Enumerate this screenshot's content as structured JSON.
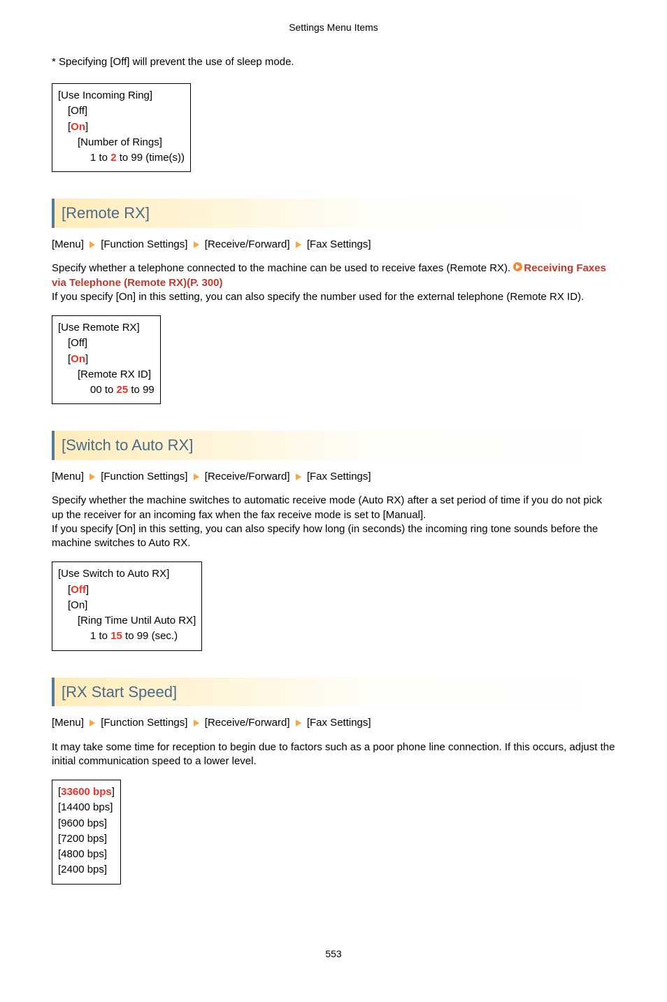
{
  "header": "Settings Menu Items",
  "note": "* Specifying [Off] will prevent the use of sleep mode.",
  "page_number": "553",
  "box1": {
    "l1": "[Use Incoming Ring]",
    "l2": "[Off]",
    "l3_pre": "[",
    "l3_val": "On",
    "l3_post": "]",
    "l4": "[Number of Rings]",
    "l5_pre": "1 to ",
    "l5_val": "2",
    "l5_post": " to 99 (time(s))"
  },
  "sec1": {
    "title": "[Remote RX]",
    "bc": [
      "[Menu]",
      "[Function Settings]",
      "[Receive/Forward]",
      "[Fax Settings]"
    ],
    "p1a": "Specify whether a telephone connected to the machine can be used to receive faxes (Remote RX). ",
    "link": "Receiving Faxes via Telephone (Remote RX)(P. 300)",
    "p2": "If you specify [On] in this setting, you can also specify the number used for the external telephone (Remote RX ID).",
    "box": {
      "l1": "[Use Remote RX]",
      "l2": "[Off]",
      "l3_pre": "[",
      "l3_val": "On",
      "l3_post": "]",
      "l4": "[Remote RX ID]",
      "l5_pre": "00 to ",
      "l5_val": "25",
      "l5_post": " to 99"
    }
  },
  "sec2": {
    "title": "[Switch to Auto RX]",
    "bc": [
      "[Menu]",
      "[Function Settings]",
      "[Receive/Forward]",
      "[Fax Settings]"
    ],
    "p1": "Specify whether the machine switches to automatic receive mode (Auto RX) after a set period of time if you do not pick up the receiver for an incoming fax when the fax receive mode is set to [Manual].",
    "p2": "If you specify [On] in this setting, you can also specify how long (in seconds) the incoming ring tone sounds before the machine switches to Auto RX.",
    "box": {
      "l1": "[Use Switch to Auto RX]",
      "l2_pre": "[",
      "l2_val": "Off",
      "l2_post": "]",
      "l3": "[On]",
      "l4": "[Ring Time Until Auto RX]",
      "l5_pre": "1 to ",
      "l5_val": "15",
      "l5_post": " to 99 (sec.)"
    }
  },
  "sec3": {
    "title": "[RX Start Speed]",
    "bc": [
      "[Menu]",
      "[Function Settings]",
      "[Receive/Forward]",
      "[Fax Settings]"
    ],
    "p1": "It may take some time for reception to begin due to factors such as a poor phone line connection. If this occurs, adjust the initial communication speed to a lower level.",
    "box": {
      "l1_pre": "[",
      "l1_val": "33600 bps",
      "l1_post": "]",
      "l2": "[14400 bps]",
      "l3": "[9600 bps]",
      "l4": "[7200 bps]",
      "l5": "[4800 bps]",
      "l6": "[2400 bps]"
    }
  }
}
